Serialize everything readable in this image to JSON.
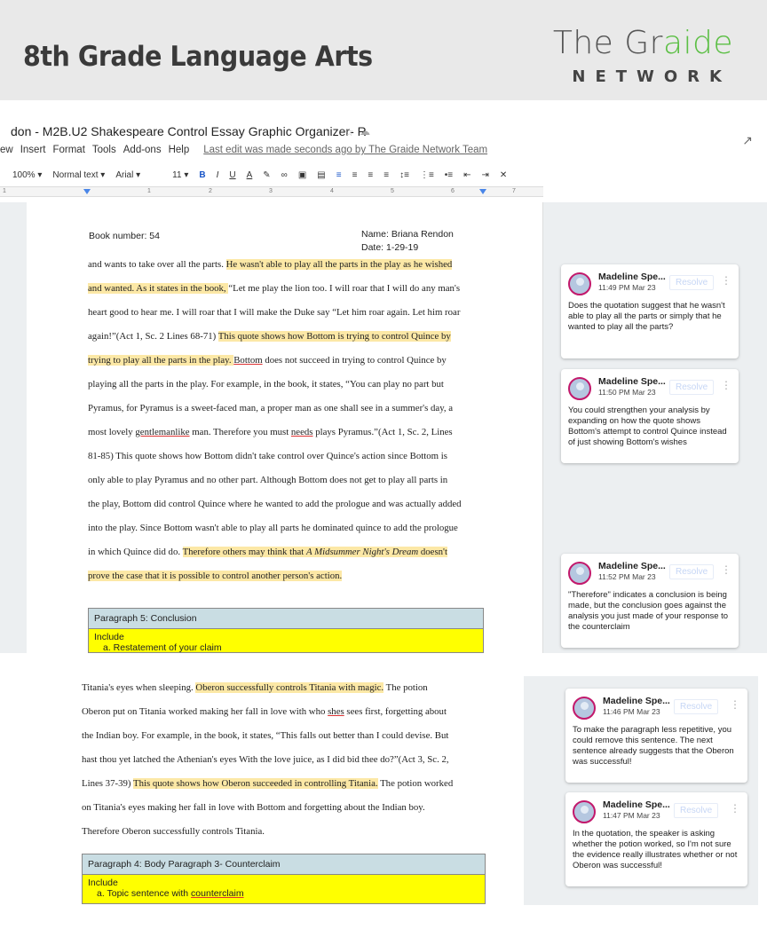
{
  "banner": {
    "title": "8th Grade Language Arts",
    "logo_main": "The Gr",
    "logo_accent": "aide",
    "logo_sub": "NETWORK"
  },
  "doc": {
    "title": "don - M2B.U2 Shakespeare Control Essay Graphic Organizer- R",
    "menus": [
      "ew",
      "Insert",
      "Format",
      "Tools",
      "Add-ons",
      "Help"
    ],
    "last_edit": "Last edit was made seconds ago by The Graide Network Team",
    "toolbar": {
      "zoom": "100%",
      "style": "Normal text",
      "font": "Arial",
      "size": "11",
      "bold": "B",
      "italic": "I",
      "underline": "U",
      "text_color": "A"
    },
    "ruler": [
      "1",
      "1",
      "2",
      "3",
      "4",
      "5",
      "6",
      "7"
    ]
  },
  "page1": {
    "book_number": "Book number: 54",
    "name": "Name: Briana Rendon",
    "date": "Date: 1-29-19",
    "lines": [
      [
        "and wants to take over all the parts. ",
        "He wasn't able to play all the parts in the play as he wished"
      ],
      [
        "and wanted. As it states in the book, ",
        "“Let me play the lion too. I will roar that I will do any man's"
      ],
      [
        "heart good to hear me. I will roar that I will make the Duke say “Let him roar again. Let him roar"
      ],
      [
        "again!”(Act 1, Sc. 2 Lines 68-71) ",
        "This quote shows how Bottom is trying to control Quince by"
      ],
      [
        "trying to play all the parts in the play. ",
        "Bottom",
        " does not succeed in trying to control Quince by"
      ],
      [
        "playing all the parts in the play. For example, in the book, it states, “You can play no part but"
      ],
      [
        "Pyramus, for Pyramus is a sweet-faced man, a proper man as one shall see in a summer's day, a"
      ],
      [
        "most lovely ",
        "gentlemanlike",
        " man. Therefore you must ",
        "needs",
        " plays Pyramus.”(Act 1, Sc. 2, Lines"
      ],
      [
        "81-85) This quote shows how Bottom didn't take control over Quince's action since Bottom is"
      ],
      [
        "only able to play Pyramus and no other part. Although Bottom does not get to play all parts in"
      ],
      [
        "the play, Bottom did control Quince where he wanted to add the prologue and was actually added"
      ],
      [
        "into the play. Since Bottom wasn't able to play all parts he dominated quince to add the prologue"
      ],
      [
        "in which Quince did do. ",
        "Therefore others may think that ",
        "A Midsummer Night's Dream",
        " doesn't"
      ],
      [
        "prove the case that it is possible to control another person's action."
      ]
    ],
    "table_head": "Paragraph 5: Conclusion",
    "table_body_1": "Include",
    "table_body_2": "a.   Restatement of your claim"
  },
  "page2": {
    "lines": [
      [
        "Titania's eyes when sleeping. ",
        "Oberon successfully controls Titania with magic.",
        " The potion"
      ],
      [
        "Oberon put on Titania worked making her fall in love with who ",
        "shes",
        " sees first, forgetting about"
      ],
      [
        "the Indian boy. For example, in the book, it states, “This falls out better than I could devise. But"
      ],
      [
        "hast thou yet latched the Athenian's eyes With the love juice, as I did bid thee do?”(Act 3, Sc. 2,"
      ],
      [
        "Lines 37-39) ",
        "This quote shows how Oberon succeeded in controlling Titania.",
        " The potion worked"
      ],
      [
        "on Titania's eyes making her fall in love with Bottom and forgetting about the Indian boy."
      ],
      [
        "Therefore Oberon successfully controls Titania."
      ]
    ],
    "table_head": "Paragraph 4: Body Paragraph 3- Counterclaim",
    "table_body_1": "Include",
    "table_body_2a": "a.   Topic sentence with ",
    "table_body_2b": "counterclaim"
  },
  "comments": [
    {
      "name": "Madeline Spe...",
      "time": "11:49 PM Mar 23",
      "resolve": "Resolve",
      "text": "Does the quotation suggest that he wasn't able to play all the parts or simply that he wanted to play all the parts?"
    },
    {
      "name": "Madeline Spe...",
      "time": "11:50 PM Mar 23",
      "resolve": "Resolve",
      "text": "You could strengthen your analysis by expanding on how the quote shows Bottom's attempt to control Quince instead of just showing Bottom's wishes"
    },
    {
      "name": "Madeline Spe...",
      "time": "11:52 PM Mar 23",
      "resolve": "Resolve",
      "text": "\"Therefore\" indicates a conclusion is being made, but the conclusion goes against the analysis you just made of your response to the counterclaim"
    },
    {
      "name": "Madeline Spe...",
      "time": "11:46 PM Mar 23",
      "resolve": "Resolve",
      "text": "To make the paragraph less repetitive, you could remove this sentence. The next sentence already suggests that the Oberon was successful!"
    },
    {
      "name": "Madeline Spe...",
      "time": "11:47 PM Mar 23",
      "resolve": "Resolve",
      "text": "In the quotation, the speaker is asking whether the potion worked, so I'm not sure the evidence really illustrates whether or not Oberon was successful!"
    }
  ]
}
